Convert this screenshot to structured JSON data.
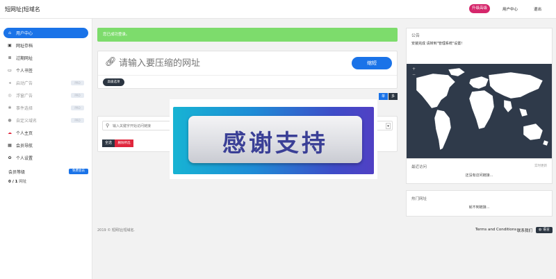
{
  "header": {
    "brand": "短网址|短域名",
    "upgrade": "升级高级",
    "user_center": "用户中心",
    "logout": "退出"
  },
  "sidebar": {
    "items": [
      {
        "label": "用户中心",
        "icon": "home-icon",
        "active": true
      },
      {
        "label": "网址存档",
        "icon": "briefcase-icon"
      },
      {
        "label": "过期网址",
        "icon": "list-icon"
      },
      {
        "label": "个人书签",
        "icon": "folder-icon"
      },
      {
        "label": "启动广告",
        "icon": "megaphone-icon",
        "pro": "PRO"
      },
      {
        "label": "浮窗广告",
        "icon": "target-icon",
        "pro": "PRO"
      },
      {
        "label": "事件选择",
        "icon": "gear-icon",
        "pro": "PRO"
      },
      {
        "label": "自定义域名",
        "icon": "globe-icon",
        "pro": "PRO"
      },
      {
        "label": "个人主页",
        "icon": "cloud-icon"
      },
      {
        "label": "会员导航",
        "icon": "grid-icon"
      },
      {
        "label": "个人设置",
        "icon": "cog-icon"
      }
    ],
    "member_label": "会员等级",
    "free_badge": "免费会员",
    "member_count_bold": "0 / 1",
    "member_count_rest": " 网址"
  },
  "alert": {
    "success": "您已成功登录。"
  },
  "shortener": {
    "placeholder": "请输入要压缩的网址",
    "button": "缩短",
    "advanced": "高级选项",
    "single": "单",
    "multi": "多"
  },
  "links": {
    "search_placeholder": "输入关键字开始访问链接",
    "all": "全选",
    "delete": "删除所选"
  },
  "promo": {
    "text": "感谢支持"
  },
  "footer": {
    "copyright": "2019 © 短网址|短域名.",
    "terms": "Terms and Conditions",
    "contact": "联系我们",
    "language": "语言"
  },
  "notice": {
    "title": "公告",
    "text": "安装完成 请转到\"管理系统\"设置!"
  },
  "recent": {
    "title": "最近访问",
    "sub": "实时更新",
    "empty": "还没有访问链接..."
  },
  "hot": {
    "title": "热门网址",
    "empty": "就不到链接..."
  },
  "colors": {
    "accent": "#1a73e8",
    "upgrade": "#d5266b",
    "success": "#7ddc6c",
    "dark": "#2b3541",
    "danger": "#e0263c",
    "map": "#2f3a4a"
  }
}
